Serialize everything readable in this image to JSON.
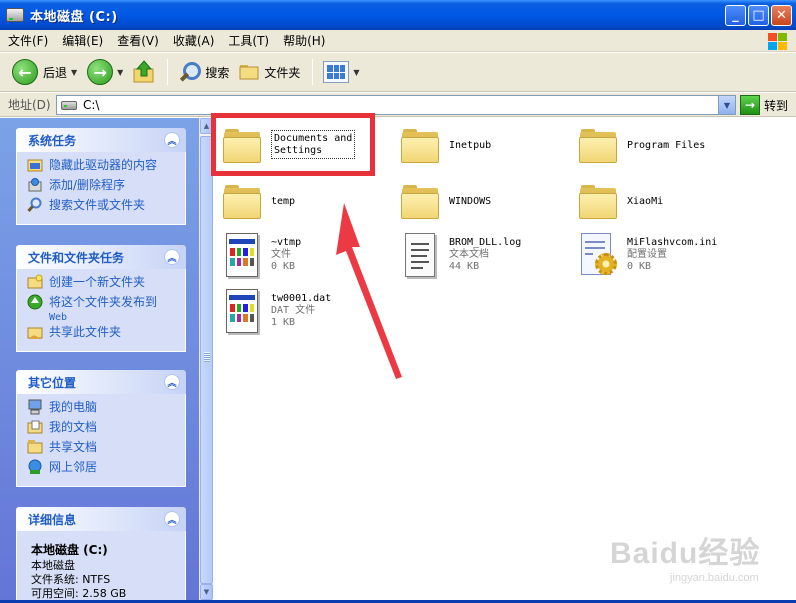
{
  "window": {
    "title": "本地磁盘  (C:)"
  },
  "menu": [
    {
      "label": "文件(F)"
    },
    {
      "label": "编辑(E)"
    },
    {
      "label": "查看(V)"
    },
    {
      "label": "收藏(A)"
    },
    {
      "label": "工具(T)"
    },
    {
      "label": "帮助(H)"
    }
  ],
  "toolbar": {
    "back": "后退",
    "search": "搜索",
    "folders": "文件夹"
  },
  "address": {
    "label": "地址(D)",
    "value": "C:\\",
    "go": "转到"
  },
  "tasks": {
    "system": {
      "title": "系统任务",
      "items": [
        {
          "label": "隐藏此驱动器的内容"
        },
        {
          "label": "添加/删除程序"
        },
        {
          "label": "搜索文件或文件夹"
        }
      ]
    },
    "file": {
      "title": "文件和文件夹任务",
      "items": [
        {
          "label": "创建一个新文件夹"
        },
        {
          "label": "将这个文件夹发布到"
        },
        {
          "label": "共享此文件夹"
        }
      ],
      "publish_web": "Web"
    },
    "places": {
      "title": "其它位置",
      "items": [
        {
          "label": "我的电脑"
        },
        {
          "label": "我的文档"
        },
        {
          "label": "共享文档"
        },
        {
          "label": "网上邻居"
        }
      ]
    },
    "details": {
      "title": "详细信息",
      "name": "本地磁盘  (C:)",
      "kind": "本地磁盘",
      "fs": "文件系统: NTFS",
      "free": "可用空间: 2.58 GB"
    }
  },
  "files": [
    {
      "name1": "Documents and",
      "name2": "Settings"
    },
    {
      "name1": "Inetpub"
    },
    {
      "name1": "Program Files"
    },
    {
      "name1": "temp"
    },
    {
      "name1": "WINDOWS"
    },
    {
      "name1": "XiaoMi"
    },
    {
      "name1": "~vtmp",
      "type": "文件",
      "size": "0 KB"
    },
    {
      "name1": "BROM_DLL.log",
      "type": "文本文档",
      "size": "44 KB"
    },
    {
      "name1": "MiFlashvcom.ini",
      "type": "配置设置",
      "size": "0 KB"
    },
    {
      "name1": "tw0001.dat",
      "type": "DAT 文件",
      "size": "1 KB"
    }
  ],
  "watermark": {
    "main": "Baidu经验",
    "sub": "jingyan.baidu.com"
  },
  "colors": {
    "titlebar": "#0058e6",
    "panel": "#6f8ddc",
    "highlight": "#e8323a",
    "link": "#215dc6"
  }
}
